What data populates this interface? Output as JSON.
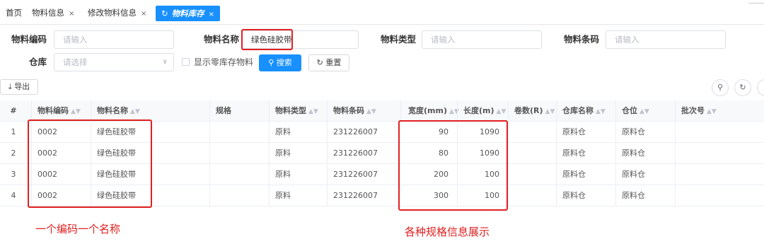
{
  "tabs": [
    {
      "label": "首页",
      "closable": false,
      "active": false
    },
    {
      "label": "物料信息",
      "closable": true,
      "active": false
    },
    {
      "label": "修改物料信息",
      "closable": true,
      "active": false
    },
    {
      "label": "物料库存",
      "closable": true,
      "active": true
    }
  ],
  "tab_close_glyph": "×",
  "tab_refresh_glyph": "↻",
  "form": {
    "material_code": {
      "label": "物料编码",
      "placeholder": "请输入",
      "value": ""
    },
    "material_name": {
      "label": "物料名称",
      "placeholder": "请输入",
      "value": "绿色硅胶带"
    },
    "material_type": {
      "label": "物料类型",
      "placeholder": "请输入",
      "value": ""
    },
    "material_barcode": {
      "label": "物料条码",
      "placeholder": "请输入",
      "value": ""
    },
    "warehouse": {
      "label": "仓库",
      "placeholder": "请选择",
      "value": ""
    },
    "show_zero_label": "显示零库存物料",
    "show_zero_checked": false,
    "search_label": "搜索",
    "reset_label": "重置"
  },
  "toolbar": {
    "export_label": "导出"
  },
  "table": {
    "columns": [
      "#",
      "物料编码",
      "物料名称",
      "规格",
      "物料类型",
      "物料条码",
      "宽度(mm)",
      "长度(m)",
      "卷数(R)",
      "仓库名称",
      "仓位",
      "批次号"
    ],
    "rows": [
      [
        "1",
        "0002",
        "绿色硅胶带",
        "",
        "原料",
        "231226007",
        "90",
        "1090",
        "",
        "原料仓",
        "原料仓",
        ""
      ],
      [
        "2",
        "0002",
        "绿色硅胶带",
        "",
        "原料",
        "231226007",
        "80",
        "1090",
        "",
        "原料仓",
        "原料仓",
        ""
      ],
      [
        "3",
        "0002",
        "绿色硅胶带",
        "",
        "原料",
        "231226007",
        "200",
        "100",
        "",
        "原料仓",
        "原料仓",
        ""
      ],
      [
        "4",
        "0002",
        "绿色硅胶带",
        "",
        "原料",
        "231226007",
        "300",
        "100",
        "",
        "原料仓",
        "原料仓",
        ""
      ]
    ]
  },
  "annotations": {
    "left": "一个编码一个名称",
    "right": "各种规格信息展示"
  },
  "colors": {
    "accent": "#1890ff",
    "annotation": "#e02020"
  }
}
